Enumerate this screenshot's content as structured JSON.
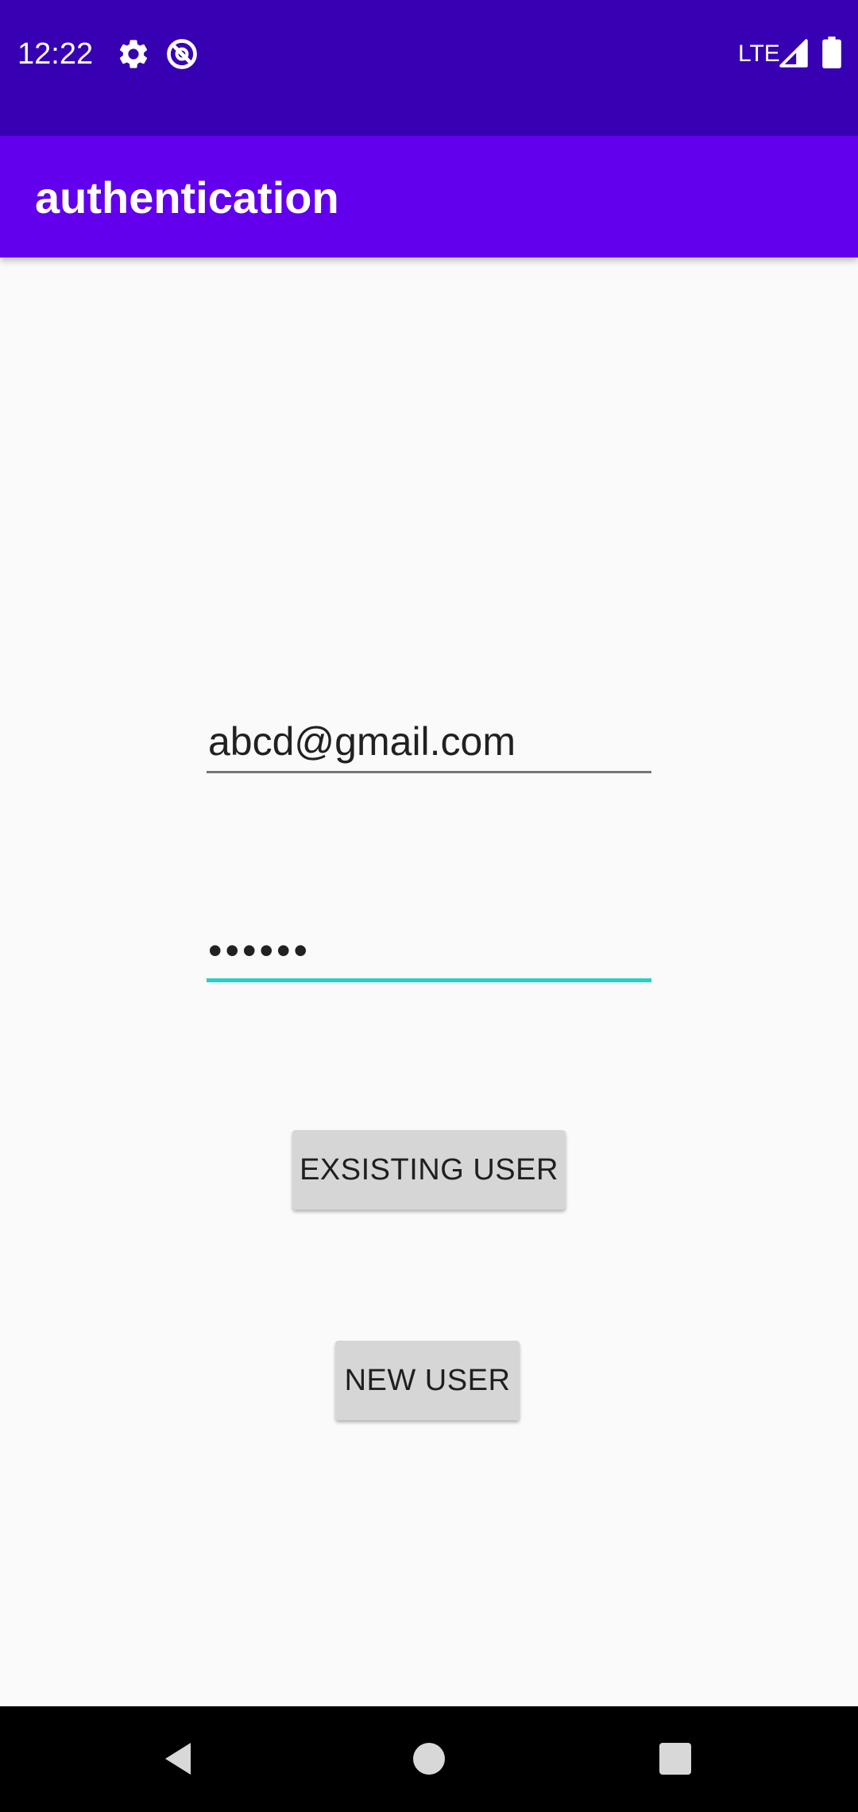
{
  "status_bar": {
    "time": "12:22",
    "icons": [
      "gear-icon",
      "do-not-disturb-icon",
      "lte-signal-icon",
      "battery-icon"
    ],
    "network": "LTE"
  },
  "app_bar": {
    "title": "authentication"
  },
  "form": {
    "email_value": "abcd@gmail.com",
    "password_value": "••••••"
  },
  "buttons": {
    "existing_user": "EXSISTING USER",
    "new_user": "NEW USER"
  },
  "nav_bar": {
    "icons": [
      "back-icon",
      "home-icon",
      "recents-icon"
    ]
  },
  "colors": {
    "status_bar": "#3700b3",
    "app_bar": "#6200ee",
    "focus_accent": "#26d0c5",
    "background": "#fafafa",
    "button": "#d6d6d6"
  }
}
